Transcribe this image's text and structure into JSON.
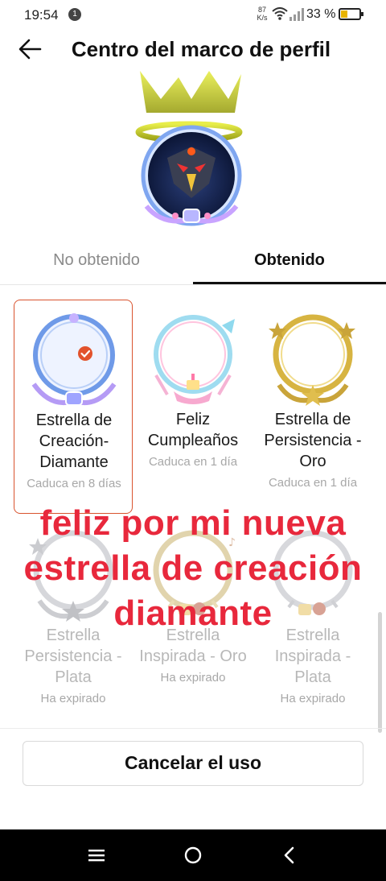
{
  "status_bar": {
    "time": "19:54",
    "notification_count": "1",
    "net_speed_value": "87",
    "net_speed_unit": "K/s",
    "battery_percent": "33 %"
  },
  "header": {
    "title": "Centro del marco de perfil"
  },
  "tabs": [
    {
      "label": "No obtenido",
      "active": false
    },
    {
      "label": "Obtenido",
      "active": true
    }
  ],
  "frames": [
    {
      "name": "Estrella de Creación-Diamante",
      "status": "Caduca en 8 días",
      "selected": true,
      "expired": false
    },
    {
      "name": "Feliz Cumpleaños",
      "status": "Caduca en 1 día",
      "selected": false,
      "expired": false
    },
    {
      "name": "Estrella de Persistencia - Oro",
      "status": "Caduca en 1 día",
      "selected": false,
      "expired": false
    },
    {
      "name": "Estrella Persistencia - Plata",
      "status": "Ha expirado",
      "selected": false,
      "expired": true
    },
    {
      "name": "Estrella Inspirada - Oro",
      "status": "Ha expirado",
      "selected": false,
      "expired": true
    },
    {
      "name": "Estrella Inspirada - Plata",
      "status": "Ha expirado",
      "selected": false,
      "expired": true
    }
  ],
  "overlay_caption": "feliz por mi nueva estrella de creación diamante",
  "cancel_button_label": "Cancelar el uso",
  "colors": {
    "accent": "#d9532e",
    "overlay_text": "#e8283c",
    "muted": "#a8a8a8"
  },
  "icons": [
    "back-arrow-icon",
    "wifi-icon",
    "signal-icon",
    "battery-icon",
    "check-icon",
    "menu-icon",
    "home-icon",
    "nav-back-icon"
  ]
}
